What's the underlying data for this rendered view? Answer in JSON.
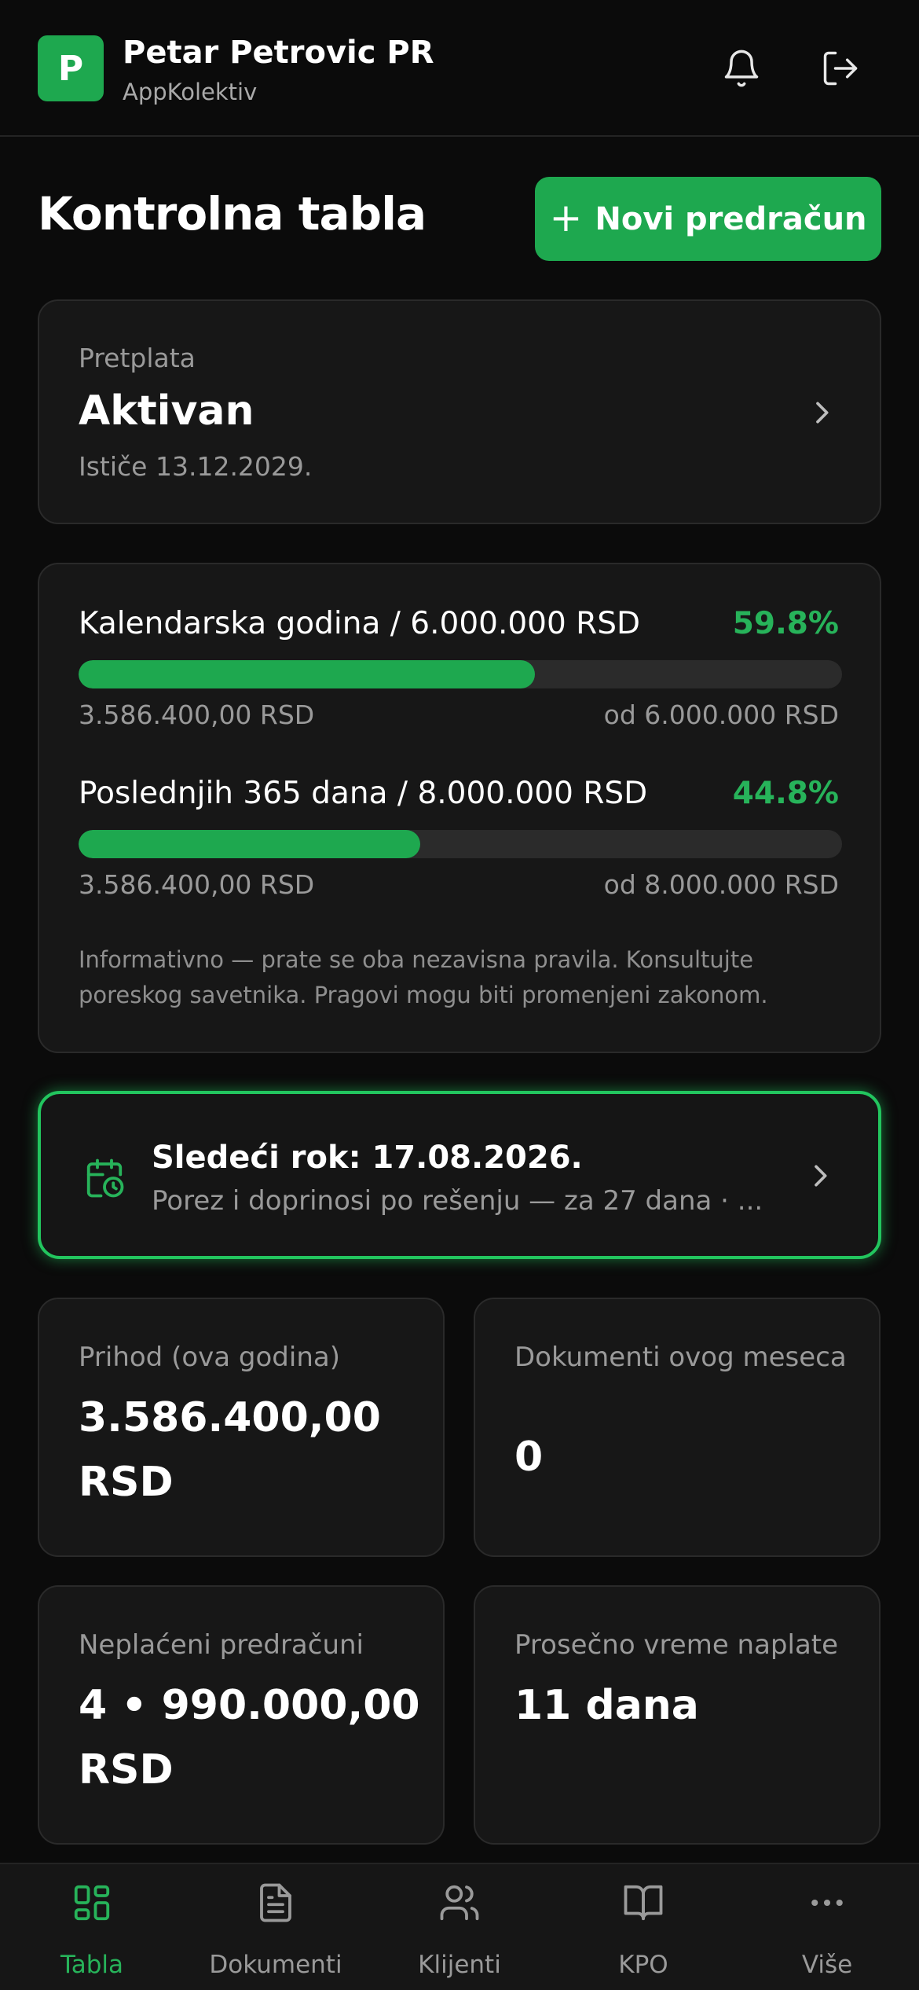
{
  "header": {
    "logo_letter": "P",
    "company_name": "Petar Petrovic PR",
    "company_sub": "AppKolektiv",
    "bell_icon": "bell-icon",
    "logout_icon": "logout-icon"
  },
  "title_row": {
    "title": "Kontrolna tabla",
    "new_button_icon": "+",
    "new_button_label": "Novi predračun"
  },
  "subscription": {
    "label": "Pretplata",
    "status": "Aktivan",
    "expiry": "Ističe 13.12.2029."
  },
  "limits": {
    "items": [
      {
        "title": "Kalendarska godina / 6.000.000 RSD",
        "percent_label": "59.8%",
        "fraction": 0.598,
        "current": "3.586.400,00 RSD",
        "of_label": "od 6.000.000 RSD"
      },
      {
        "title": "Poslednjih 365 dana / 8.000.000 RSD",
        "percent_label": "44.8%",
        "fraction": 0.448,
        "current": "3.586.400,00 RSD",
        "of_label": "od 8.000.000 RSD"
      }
    ],
    "note": "Informativno — prate se oba nezavisna pravila. Konsultujte poreskog savetnika. Pragovi mogu biti promenjeni zakonom."
  },
  "deadline": {
    "icon": "calendar-clock-icon",
    "title": "Sledeći rok: 17.08.2026.",
    "subtitle": "Porez i doprinosi po rešenju — za 27 dana · ...",
    "accent": "#22c55e"
  },
  "stats": [
    {
      "label": "Prihod (ova godina)",
      "value": "3.586.400,00 RSD"
    },
    {
      "label": "Dokumenti ovog meseca",
      "value": "0"
    },
    {
      "label": "Neplaćeni predračuni",
      "value": "4 • 990.000,00 RSD"
    },
    {
      "label": "Prosečno vreme naplate",
      "value": "11 dana"
    }
  ],
  "nav": {
    "items": [
      {
        "label": "Tabla",
        "icon": "grid-icon",
        "active": true
      },
      {
        "label": "Dokumenti",
        "icon": "document-icon",
        "active": false
      },
      {
        "label": "Klijenti",
        "icon": "users-icon",
        "active": false
      },
      {
        "label": "KPO",
        "icon": "book-icon",
        "active": false
      },
      {
        "label": "Više",
        "icon": "more-icon",
        "active": false
      }
    ]
  },
  "colors": {
    "accent": "#1ea84f",
    "accent_text": "#27b35a",
    "background": "#0b0b0b",
    "card": "#171717"
  }
}
